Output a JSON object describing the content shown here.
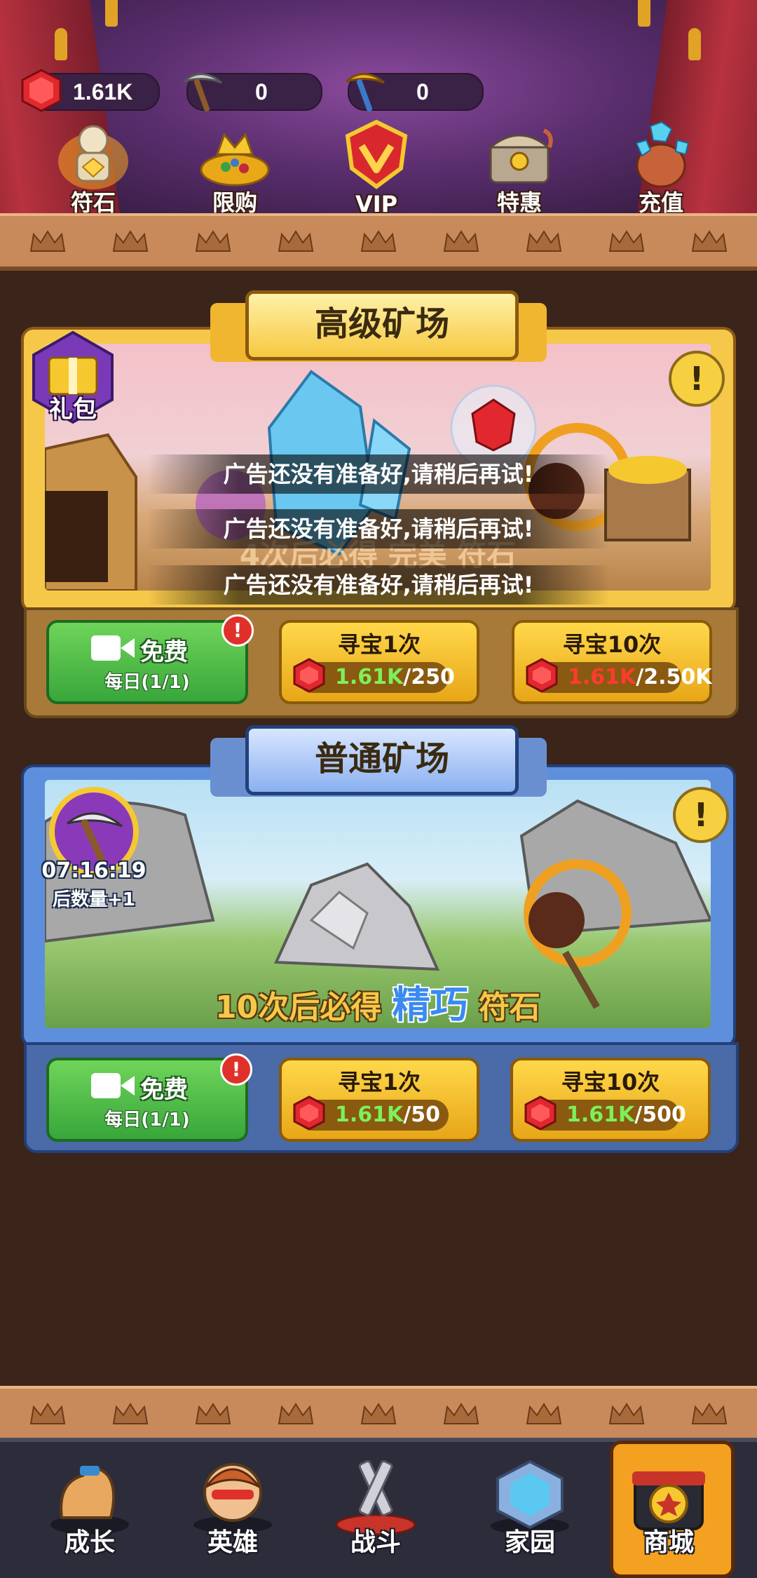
{
  "resources": {
    "gems": "1.61K",
    "pickaxe": "0",
    "golden_pickaxe": "0"
  },
  "top_menu": [
    {
      "label": "符石",
      "icon": "rune-statue-icon"
    },
    {
      "label": "限购",
      "icon": "treasure-pile-icon"
    },
    {
      "label": "VIP",
      "icon": "vip-badge-icon"
    },
    {
      "label": "特惠",
      "icon": "special-chest-icon"
    },
    {
      "label": "充值",
      "icon": "gem-bag-icon"
    }
  ],
  "advanced_mine": {
    "title": "高级矿场",
    "gift_label": "礼包",
    "guarantee_text": "4次后必得 完美 符石",
    "toasts": [
      "广告还没有准备好,请稍后再试!",
      "广告还没有准备好,请稍后再试!",
      "广告还没有准备好,请稍后再试!"
    ],
    "free_label": "免费",
    "free_daily": "每日(1/1)",
    "single_label": "寻宝1次",
    "single_have": "1.61K",
    "single_cost": "/250",
    "ten_label": "寻宝10次",
    "ten_have": "1.61K",
    "ten_cost": "/2.50K"
  },
  "normal_mine": {
    "title": "普通矿场",
    "timer": "07:16:19",
    "timer_suffix": "后数量+1",
    "guarantee_prefix": "10次后必得",
    "guarantee_quality": "精巧",
    "guarantee_suffix": "符石",
    "free_label": "免费",
    "free_daily": "每日(1/1)",
    "single_label": "寻宝1次",
    "single_have": "1.61K",
    "single_cost": "/50",
    "ten_label": "寻宝10次",
    "ten_have": "1.61K",
    "ten_cost": "/500"
  },
  "bottom_nav": [
    {
      "label": "成长"
    },
    {
      "label": "英雄"
    },
    {
      "label": "战斗"
    },
    {
      "label": "家园"
    },
    {
      "label": "商城"
    }
  ],
  "colors": {
    "have_ok": "#7df05a",
    "have_insufficient": "#ff3b30",
    "gold_panel": "#f6c84a",
    "blue_panel": "#5e8fdc",
    "background": "#3b2419"
  }
}
